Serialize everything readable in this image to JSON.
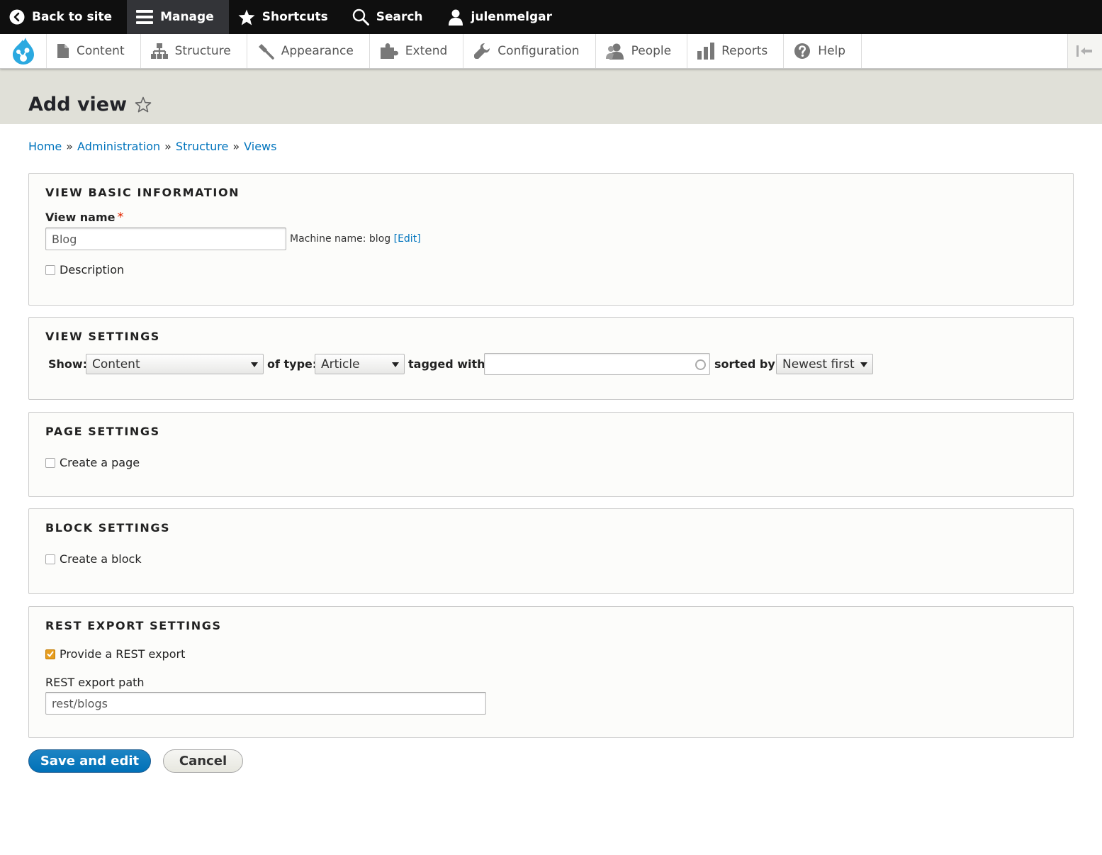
{
  "toolbar": {
    "back_to_site": "Back to site",
    "manage": "Manage",
    "shortcuts": "Shortcuts",
    "search": "Search",
    "user": "julenmelgar"
  },
  "tray": {
    "items": [
      {
        "label": "Content",
        "icon": "file-icon"
      },
      {
        "label": "Structure",
        "icon": "sitemap-icon"
      },
      {
        "label": "Appearance",
        "icon": "paint-icon"
      },
      {
        "label": "Extend",
        "icon": "puzzle-icon"
      },
      {
        "label": "Configuration",
        "icon": "wrench-icon"
      },
      {
        "label": "People",
        "icon": "people-icon"
      },
      {
        "label": "Reports",
        "icon": "bar-chart-icon"
      },
      {
        "label": "Help",
        "icon": "help-icon"
      }
    ]
  },
  "page": {
    "title": "Add view"
  },
  "breadcrumb": {
    "items": [
      "Home",
      "Administration",
      "Structure",
      "Views"
    ],
    "separator": "»"
  },
  "basic_info": {
    "legend": "View basic information",
    "view_name_label": "View name",
    "required_mark": "*",
    "view_name_value": "Blog",
    "machine_name_prefix": "Machine name: blog ",
    "edit_open": "[",
    "edit_link": "Edit",
    "edit_close": "]",
    "description_label": "Description"
  },
  "view_settings": {
    "legend": "View settings",
    "show_label": "Show:",
    "show_value": "Content",
    "type_label": "of type:",
    "type_value": "Article",
    "tagged_label": "tagged with:",
    "tagged_value": "",
    "sorted_label": "sorted by:",
    "sorted_value": "Newest first"
  },
  "page_settings": {
    "legend": "Page settings",
    "create_page_label": "Create a page"
  },
  "block_settings": {
    "legend": "Block settings",
    "create_block_label": "Create a block"
  },
  "rest_settings": {
    "legend": "REST export settings",
    "provide_label": "Provide a REST export",
    "provide_checked": true,
    "path_label": "REST export path",
    "path_value": "rest/blogs"
  },
  "actions": {
    "save": "Save and edit",
    "cancel": "Cancel"
  },
  "colors": {
    "link": "#0074bd",
    "primary_button": "#0071b8",
    "checkbox_checked": "#e69d1f",
    "required": "#e32700"
  }
}
